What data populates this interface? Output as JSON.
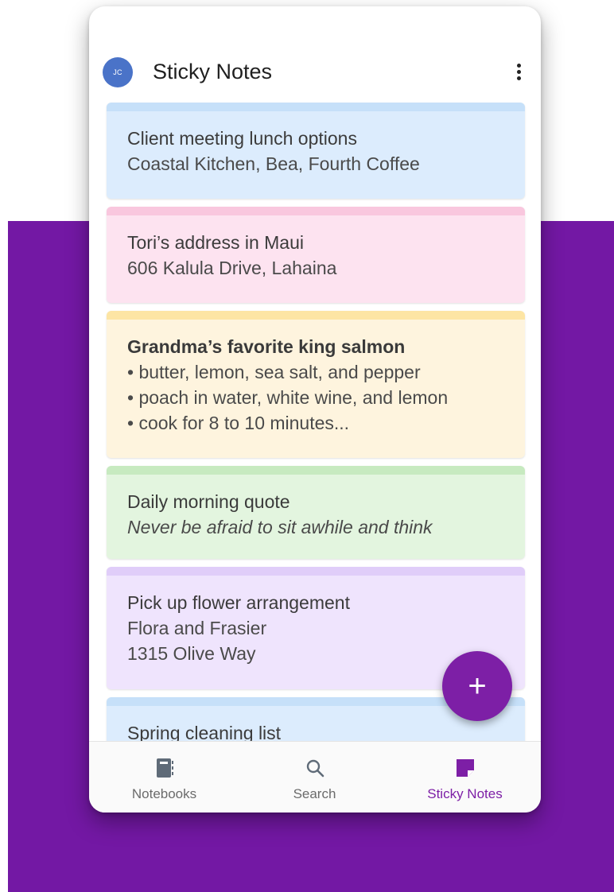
{
  "app": {
    "title": "Sticky Notes",
    "avatar_initials": "JC"
  },
  "notes": [
    {
      "title": "Client meeting lunch options",
      "lines": [
        "Coastal Kitchen, Bea, Fourth Coffee"
      ],
      "color": "#dcecfd"
    },
    {
      "title": "Tori’s address in Maui",
      "lines": [
        "606 Kalula Drive, Lahaina"
      ],
      "color": "#fde3f0"
    },
    {
      "title": "Grandma’s favorite king salmon",
      "lines": [
        "• butter, lemon, sea salt, and pepper",
        "• poach in water, white wine, and lemon",
        "• cook for 8 to 10 minutes..."
      ],
      "color": "#fef4de"
    },
    {
      "title": "Daily morning quote",
      "lines": [
        "Never be afraid to sit awhile and think"
      ],
      "color": "#e3f5df"
    },
    {
      "title": "Pick up flower arrangement",
      "lines": [
        "Flora and Frasier",
        "1315 Olive Way"
      ],
      "color": "#efe4fd"
    },
    {
      "title": "Spring cleaning list",
      "lines": [],
      "color": "#dcecfd"
    }
  ],
  "fab": {
    "label": "+"
  },
  "nav": {
    "items": [
      {
        "label": "Notebooks",
        "icon": "notebook-icon",
        "active": false
      },
      {
        "label": "Search",
        "icon": "search-icon",
        "active": false
      },
      {
        "label": "Sticky Notes",
        "icon": "sticky-note-icon",
        "active": true
      }
    ]
  },
  "colors": {
    "accent": "#7d1fa6",
    "background_band": "#7318a4"
  }
}
